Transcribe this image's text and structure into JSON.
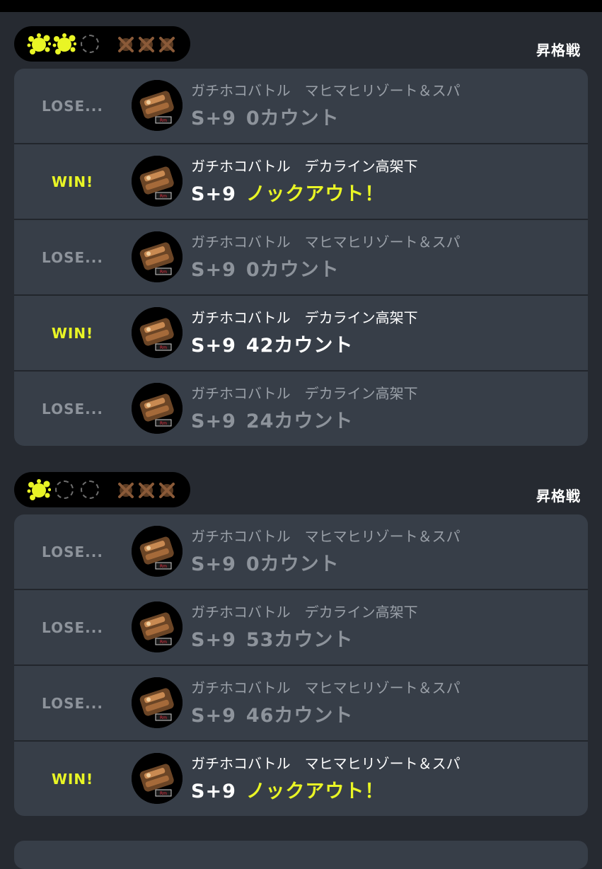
{
  "promo_label": "昇格戦",
  "result_win": "WIN!",
  "result_lose": "LOSE...",
  "colors": {
    "win": "#e9f525",
    "lose": "#8d939b",
    "card": "#373e48",
    "background": "#262a31"
  },
  "groups": [
    {
      "wins_shown": 2,
      "empty_slots": 1,
      "losses_shown": 3,
      "matches": [
        {
          "result": "lose",
          "mode": "ガチホコバトル",
          "stage": "マヒマヒリゾート＆スパ",
          "rank": "S+9",
          "count": "0カウント"
        },
        {
          "result": "win",
          "mode": "ガチホコバトル",
          "stage": "デカライン高架下",
          "rank": "S+9",
          "count": "ノックアウト！"
        },
        {
          "result": "lose",
          "mode": "ガチホコバトル",
          "stage": "マヒマヒリゾート＆スパ",
          "rank": "S+9",
          "count": "0カウント"
        },
        {
          "result": "win",
          "mode": "ガチホコバトル",
          "stage": "デカライン高架下",
          "rank": "S+9",
          "count": "42カウント"
        },
        {
          "result": "lose",
          "mode": "ガチホコバトル",
          "stage": "デカライン高架下",
          "rank": "S+9",
          "count": "24カウント"
        }
      ]
    },
    {
      "wins_shown": 1,
      "empty_slots": 2,
      "losses_shown": 3,
      "matches": [
        {
          "result": "lose",
          "mode": "ガチホコバトル",
          "stage": "マヒマヒリゾート＆スパ",
          "rank": "S+9",
          "count": "0カウント"
        },
        {
          "result": "lose",
          "mode": "ガチホコバトル",
          "stage": "デカライン高架下",
          "rank": "S+9",
          "count": "53カウント"
        },
        {
          "result": "lose",
          "mode": "ガチホコバトル",
          "stage": "マヒマヒリゾート＆スパ",
          "rank": "S+9",
          "count": "46カウント"
        },
        {
          "result": "win",
          "mode": "ガチホコバトル",
          "stage": "マヒマヒリゾート＆スパ",
          "rank": "S+9",
          "count": "ノックアウト！"
        }
      ]
    }
  ]
}
